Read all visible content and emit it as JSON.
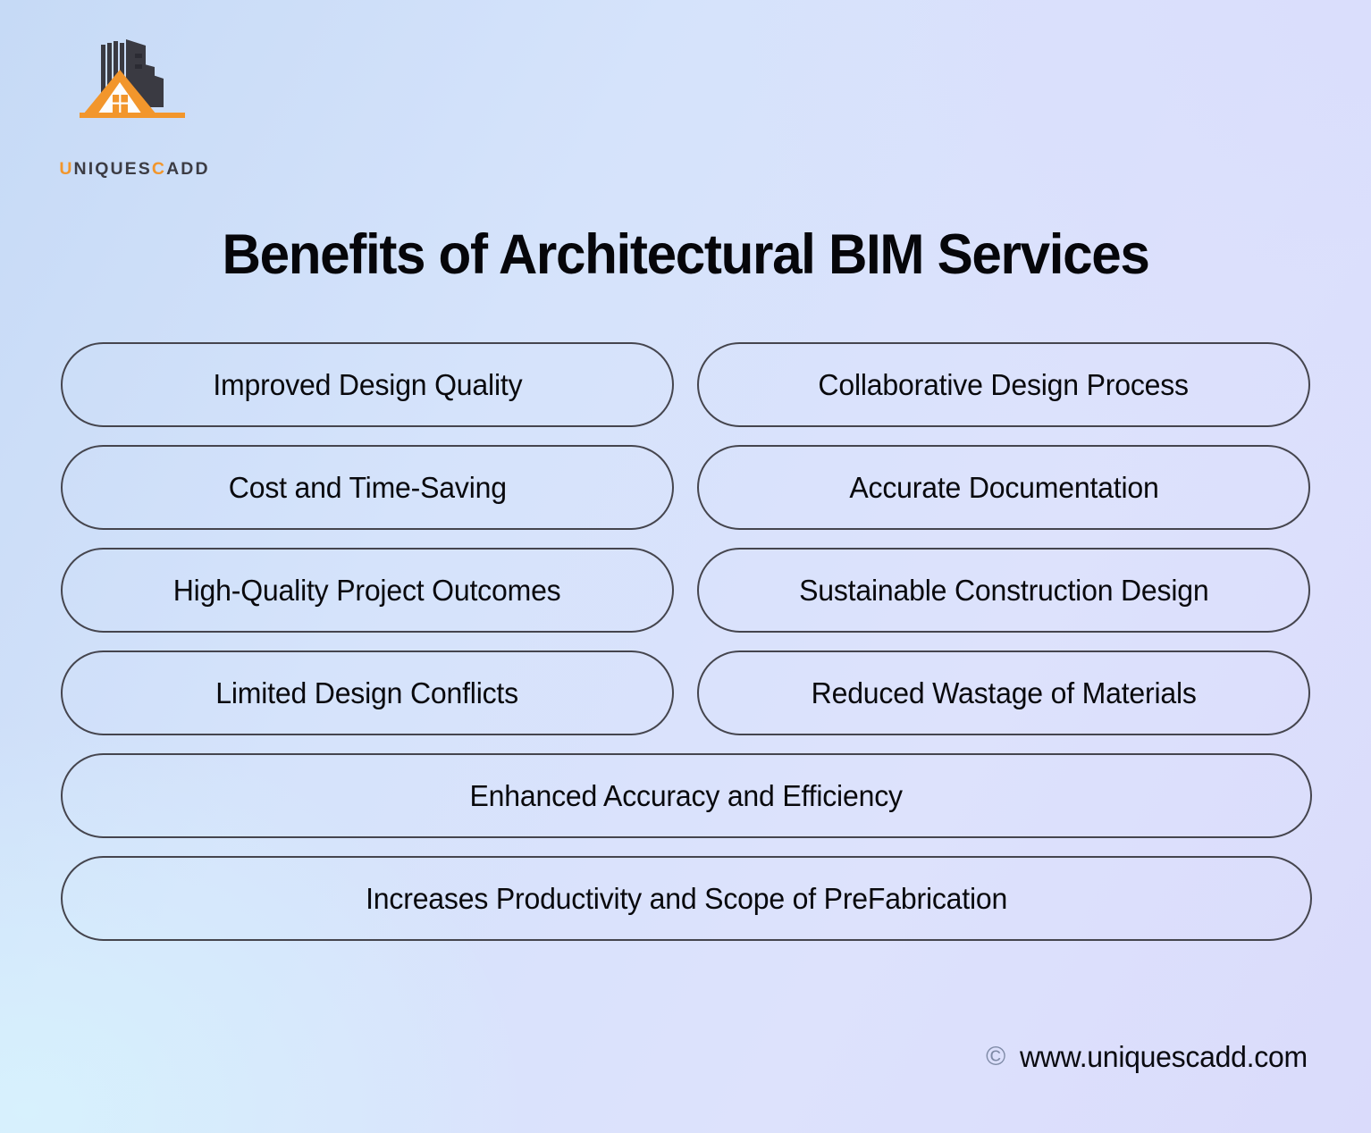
{
  "brand": {
    "logo_icon": "building-house-logo-icon",
    "wordmark_prefix": "U",
    "wordmark_mid": "NIQUES",
    "wordmark_accent": "C",
    "wordmark_suffix": "ADD",
    "wordmark_full": "UNIQUESCADD",
    "accent_color": "#f2962c",
    "dark_color": "#3c3c44"
  },
  "header": {
    "title": "Benefits of Architectural BIM Services"
  },
  "benefits": [
    {
      "label": "Improved Design Quality",
      "span": "half"
    },
    {
      "label": "Collaborative Design Process",
      "span": "half"
    },
    {
      "label": "Cost and Time-Saving",
      "span": "half"
    },
    {
      "label": "Accurate Documentation",
      "span": "half"
    },
    {
      "label": "High-Quality Project Outcomes",
      "span": "half"
    },
    {
      "label": "Sustainable Construction Design",
      "span": "half"
    },
    {
      "label": "Limited Design Conflicts",
      "span": "half"
    },
    {
      "label": "Reduced Wastage of Materials",
      "span": "half"
    },
    {
      "label": "Enhanced Accuracy and Efficiency",
      "span": "full"
    },
    {
      "label": "Increases Productivity and Scope of PreFabrication",
      "span": "full"
    }
  ],
  "footer": {
    "copyright_symbol": "©",
    "website": "www.uniquescadd.com"
  },
  "theme": {
    "background_top_left": "#c6daf6",
    "background_top_right": "#dadefc",
    "background_bottom_left": "#d7f1fd",
    "pill_border": "#45454e",
    "text_color": "#09090d"
  }
}
